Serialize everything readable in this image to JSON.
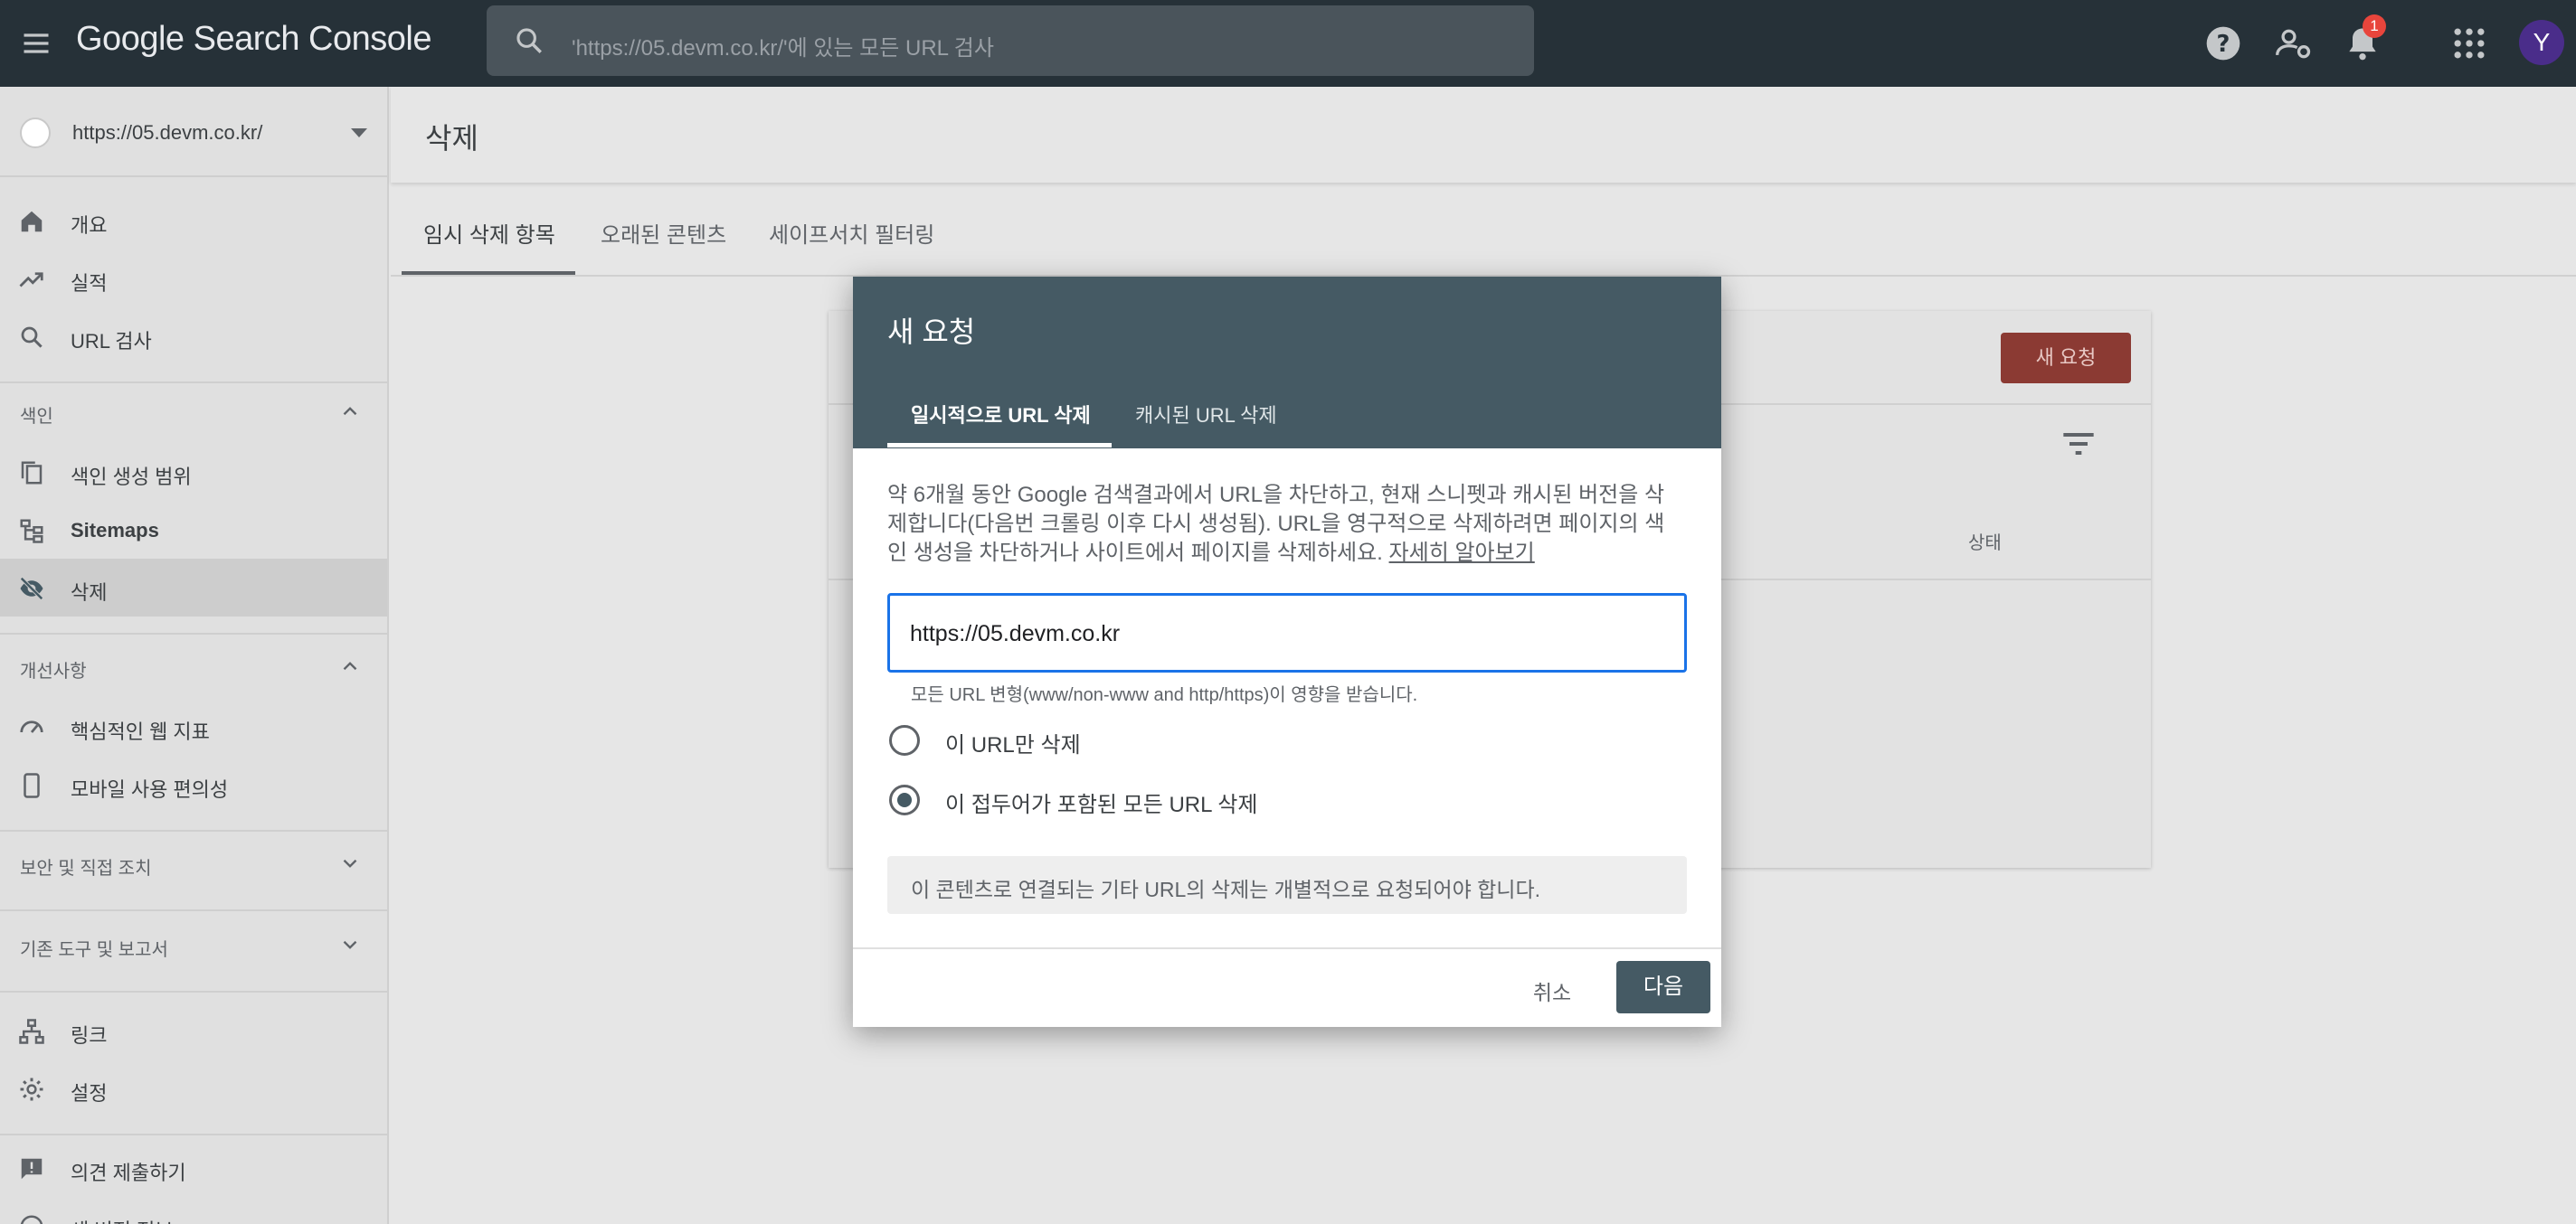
{
  "app": {
    "title": "Google Search Console"
  },
  "search": {
    "placeholder": "'https://05.devm.co.kr/'에 있는 모든 URL 검사"
  },
  "header": {
    "notification_count": "1",
    "avatar_letter": "Y",
    "accent": "#263138"
  },
  "property": {
    "url": "https://05.devm.co.kr/"
  },
  "sidebar": {
    "top_items": [
      {
        "label": "개요",
        "icon": "home-icon"
      },
      {
        "label": "실적",
        "icon": "trending-up-icon"
      },
      {
        "label": "URL 검사",
        "icon": "search-icon"
      }
    ],
    "index_section": {
      "title": "색인",
      "items": [
        {
          "label": "색인 생성 범위",
          "icon": "copy-icon"
        },
        {
          "label": "Sitemaps",
          "icon": "sitemap-icon"
        },
        {
          "label": "삭제",
          "icon": "eye-off-icon"
        }
      ]
    },
    "enhancements_section": {
      "title": "개선사항",
      "items": [
        {
          "label": "핵심적인 웹 지표",
          "icon": "speed-gauge-icon"
        },
        {
          "label": "모바일 사용 편의성",
          "icon": "phone-icon"
        }
      ]
    },
    "security_section": {
      "title": "보안 및 직접 조치"
    },
    "legacy_section": {
      "title": "기존 도구 및 보고서"
    },
    "bottom_items": [
      {
        "label": "링크",
        "icon": "links-icon"
      },
      {
        "label": "설정",
        "icon": "settings-icon"
      }
    ],
    "footer_items": [
      {
        "label": "의견 제출하기",
        "icon": "feedback-icon"
      },
      {
        "label": "새 버전 정보",
        "icon": "info-icon"
      }
    ]
  },
  "page": {
    "title": "삭제",
    "tabs": [
      "임시 삭제 항목",
      "오래된 콘텐츠",
      "세이프서치 필터링"
    ]
  },
  "card": {
    "new_request_label": "새 요청",
    "status_column": "상태",
    "brand_color": "#db4437"
  },
  "dialog": {
    "title": "새 요청",
    "tabs": [
      "일시적으로 URL 삭제",
      "캐시된 URL 삭제"
    ],
    "description": "약 6개월 동안 Google 검색결과에서 URL을 차단하고, 현재 스니펫과 캐시된 버전을 삭제합니다(다음번 크롤링 이후 다시 생성됨). URL을 영구적으로 삭제하려면 페이지의 색인 생성을 차단하거나 사이트에서 페이지를 삭제하세요.",
    "learn_more": "자세히 알아보기",
    "url_value": "https://05.devm.co.kr",
    "hint": "모든 URL 변형(www/non-www and http/https)이 영향을 받습니다.",
    "options": [
      {
        "label": "이 URL만 삭제",
        "selected": false
      },
      {
        "label": "이 접두어가 포함된 모든 URL 삭제",
        "selected": true
      }
    ],
    "note": "이 콘텐츠로 연결되는 기타 URL의 삭제는 개별적으로 요청되어야 합니다.",
    "cancel_label": "취소",
    "next_label": "다음"
  }
}
